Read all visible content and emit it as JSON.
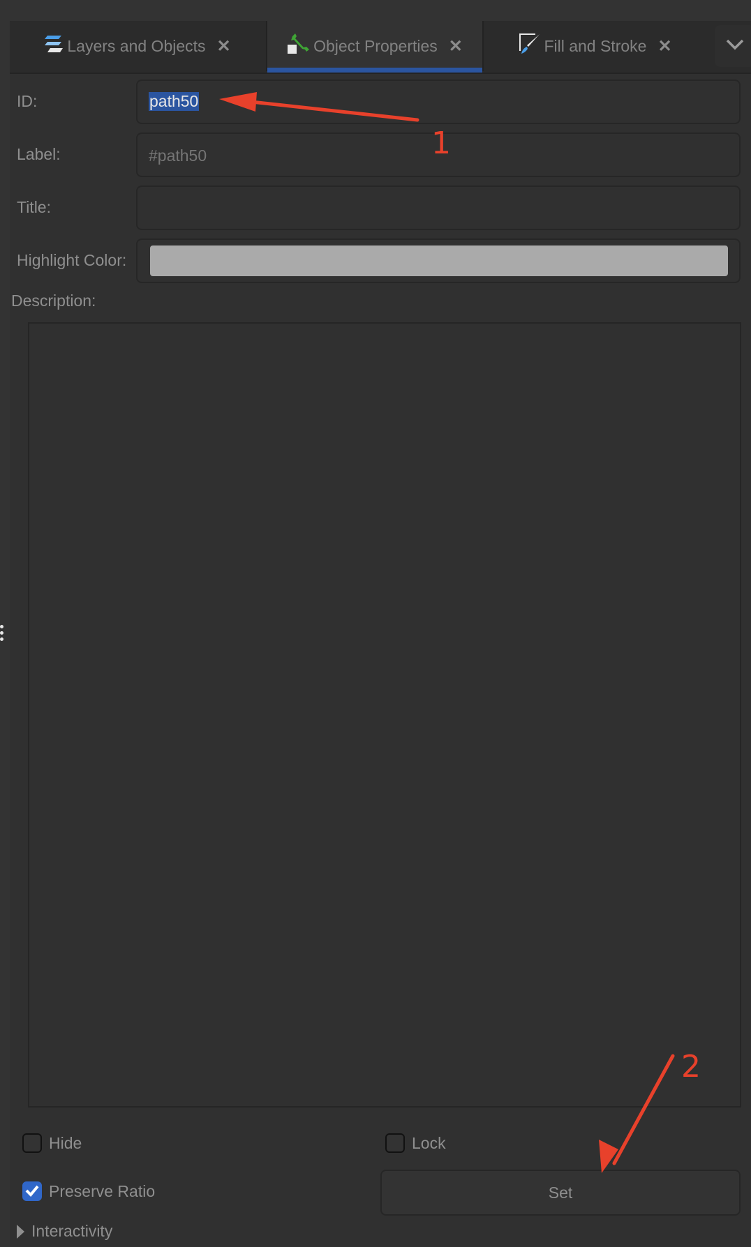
{
  "tabs": [
    {
      "label": "Layers and Objects",
      "icon": "layers-icon",
      "active": false
    },
    {
      "label": "Object Properties",
      "icon": "wrench-icon",
      "active": true
    },
    {
      "label": "Fill and Stroke",
      "icon": "paintbrush-icon",
      "active": false
    }
  ],
  "tab_close_glyph": "✕",
  "form": {
    "id_label": "ID:",
    "id_value": "path50",
    "label_label": "Label:",
    "label_placeholder": "#path50",
    "title_label": "Title:",
    "title_value": "",
    "highlight_label": "Highlight Color:",
    "highlight_color": "#aaaaaa",
    "description_label": "Description:",
    "description_value": ""
  },
  "options": {
    "hide_label": "Hide",
    "hide_checked": false,
    "lock_label": "Lock",
    "lock_checked": false,
    "preserve_label": "Preserve Ratio",
    "preserve_checked": true,
    "set_label": "Set",
    "interactivity_label": "Interactivity"
  },
  "annotations": {
    "one": "1",
    "two": "2",
    "color": "#e8412b"
  },
  "colors": {
    "accent": "#2b55a0",
    "checkbox": "#3067c9",
    "background": "#303030"
  }
}
